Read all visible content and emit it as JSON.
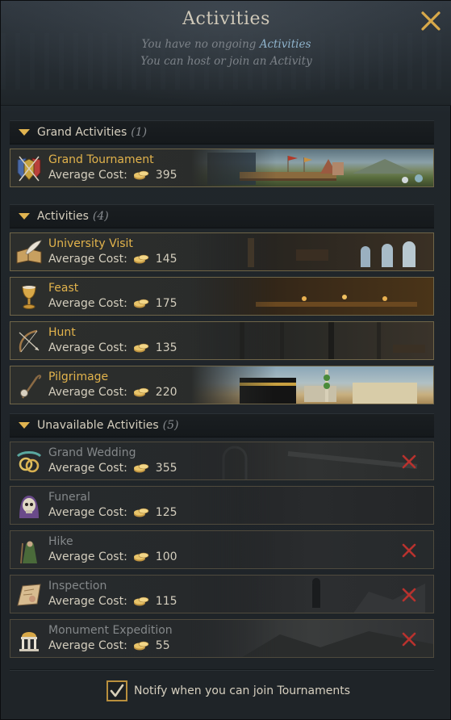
{
  "window": {
    "title": "Activities",
    "status_line_prefix": "You have no ongoing ",
    "status_line_link": "Activities",
    "host_line": "You can host or join an Activity"
  },
  "sections": [
    {
      "label": "Grand Activities",
      "count": "(1)",
      "items": [
        {
          "name": "Grand Tournament",
          "cost_label": "Average Cost:",
          "cost": "395",
          "icon": "tournament-shields-icon",
          "available": true
        }
      ]
    },
    {
      "label": "Activities",
      "count": "(4)",
      "items": [
        {
          "name": "University Visit",
          "cost_label": "Average Cost:",
          "cost": "145",
          "icon": "book-quill-icon",
          "available": true
        },
        {
          "name": "Feast",
          "cost_label": "Average Cost:",
          "cost": "175",
          "icon": "goblet-icon",
          "available": true
        },
        {
          "name": "Hunt",
          "cost_label": "Average Cost:",
          "cost": "135",
          "icon": "bow-icon",
          "available": true
        },
        {
          "name": "Pilgrimage",
          "cost_label": "Average Cost:",
          "cost": "220",
          "icon": "pilgrim-staff-icon",
          "available": true
        }
      ]
    },
    {
      "label": "Unavailable Activities",
      "count": "(5)",
      "items": [
        {
          "name": "Grand Wedding",
          "cost_label": "Average Cost:",
          "cost": "355",
          "icon": "wedding-rings-icon",
          "available": false,
          "blocked": true
        },
        {
          "name": "Funeral",
          "cost_label": "Average Cost:",
          "cost": "125",
          "icon": "skull-icon",
          "available": false,
          "blocked": false
        },
        {
          "name": "Hike",
          "cost_label": "Average Cost:",
          "cost": "100",
          "icon": "hiker-icon",
          "available": false,
          "blocked": true
        },
        {
          "name": "Inspection",
          "cost_label": "Average Cost:",
          "cost": "115",
          "icon": "map-scroll-icon",
          "available": false,
          "blocked": true
        },
        {
          "name": "Monument Expedition",
          "cost_label": "Average Cost:",
          "cost": "55",
          "icon": "monument-icon",
          "available": false,
          "blocked": true
        }
      ]
    }
  ],
  "footer": {
    "notify_label": "Notify when you can join Tournaments",
    "notify_checked": true
  },
  "colors": {
    "accent_gold": "#e2b34c",
    "link_blue": "#8fb3cc",
    "blocked_red": "#b8322e"
  }
}
